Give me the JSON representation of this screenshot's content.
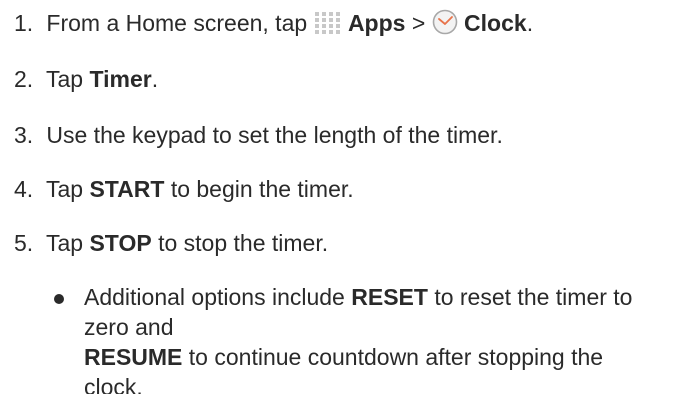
{
  "steps": [
    {
      "number": "1.",
      "pre": "From a Home screen, tap",
      "apps_label": "Apps",
      "separator": ">",
      "clock_label": "Clock",
      "end": "."
    },
    {
      "number": "2.",
      "pre": "Tap",
      "bold": "Timer",
      "end": "."
    },
    {
      "number": "3.",
      "text": "Use the keypad to set the length of the timer."
    },
    {
      "number": "4.",
      "pre": "Tap",
      "bold": "START",
      "post": "to begin the timer."
    },
    {
      "number": "5.",
      "pre": "Tap",
      "bold": "STOP",
      "post": "to stop the timer."
    }
  ],
  "bullet": {
    "pre": "Additional options include",
    "bold1": "RESET",
    "mid": "to reset the timer to zero and",
    "bold2": "RESUME",
    "post": "to continue countdown after stopping the clock."
  },
  "icons": {
    "apps": "apps-grid-icon",
    "clock": "clock-icon"
  },
  "colors": {
    "apps_icon": "#c8c8c8",
    "clock_outline": "#a8a8a8",
    "clock_hands": "#e8734a",
    "text": "#2a2a2a"
  }
}
